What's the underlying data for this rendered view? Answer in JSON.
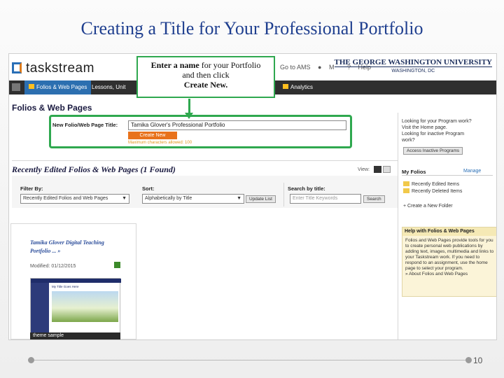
{
  "slide": {
    "title": "Creating a Title for Your Professional Portfolio",
    "page_number": "10"
  },
  "callout": {
    "bold1": "Enter a name",
    "text1": " for your Portfolio",
    "text2": "and then click",
    "bold2": "Create New."
  },
  "header": {
    "logo_text": "taskstream",
    "links": [
      "Go to AMS",
      "M",
      "Help"
    ],
    "university": "THE GEORGE WASHINGTON UNIVERSITY",
    "city": "WASHINGTON, DC"
  },
  "nav": {
    "tabs": [
      "Folios & Web Pages",
      "Lessons, Unit",
      "Analytics"
    ]
  },
  "main": {
    "section_title": "Folios & Web Pages",
    "form_label": "New Folio/Web Page Title:",
    "form_value": "Tamika Glover's Professional Portfolio",
    "create_button": "Create New",
    "max_hint": "Maximum characters allowed: 100"
  },
  "right_panel": {
    "link1": "Looking for your Program work?",
    "link2": "Visit the Home page.",
    "link3": "Looking for inactive Program",
    "link4": "work?",
    "access_button": "Access Inactive Programs",
    "my_folios": "My Folios",
    "manage": "Manage",
    "recent_edited": "Recently Edited Items",
    "recent_deleted": "Recently Deleted Items",
    "create_folder": "Create a New Folder"
  },
  "recent": {
    "title": "Recently Edited Folios & Web Pages (1 Found)",
    "view_label": "View:",
    "filter_label": "Filter By:",
    "filter_value": "Recently Edited Folios and Web Pages",
    "sort_label": "Sort:",
    "sort_value": "Alphabetically by Title",
    "update_button": "Update List",
    "search_label": "Search by title:",
    "search_placeholder": "Enter Title Keywords",
    "search_button": "Search"
  },
  "item": {
    "title1": "Tamika Glover Digital Teaching",
    "title2": "Portfolio ... »",
    "modified": "Modified: 01/12/2015",
    "mini_header": "My Title Goes Here",
    "theme": "theme sample"
  },
  "help": {
    "heading": "Help with Folios & Web Pages",
    "text": "Folios and Web Pages provide tools for you to create personal web publications by adding text, images, multimedia and links to your Taskstream work. If you need to respond to an assignment, use the home page to select your program.",
    "link": "About Folios and Web Pages"
  }
}
